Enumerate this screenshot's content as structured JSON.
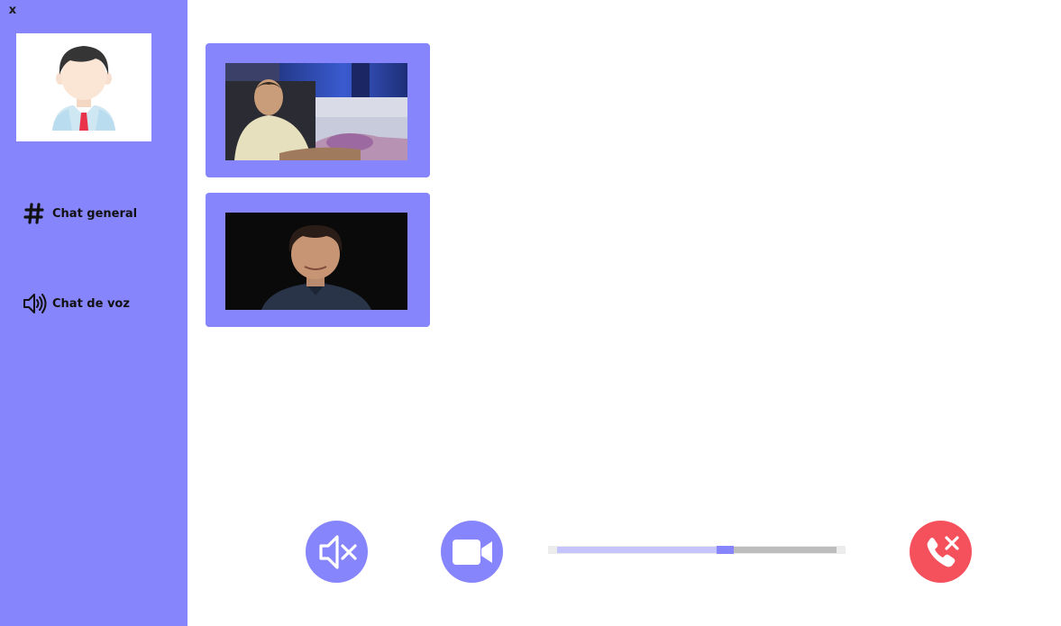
{
  "window": {
    "close_label": "x"
  },
  "sidebar": {
    "background": "#8785fb",
    "avatar_icon": "user-avatar-icon",
    "items": [
      {
        "label": "Chat general",
        "icon": "hash-icon"
      },
      {
        "label": "Chat de voz",
        "icon": "speaker-icon"
      }
    ]
  },
  "videos": [
    {
      "icon": "participant-video-1"
    },
    {
      "icon": "participant-video-2"
    }
  ],
  "controls": {
    "mute_icon": "speaker-muted-icon",
    "camera_icon": "video-camera-icon",
    "hangup_icon": "phone-hangup-icon",
    "accent": "#8785fb",
    "hangup_color": "#f5515d",
    "volume_level": 0.6
  }
}
